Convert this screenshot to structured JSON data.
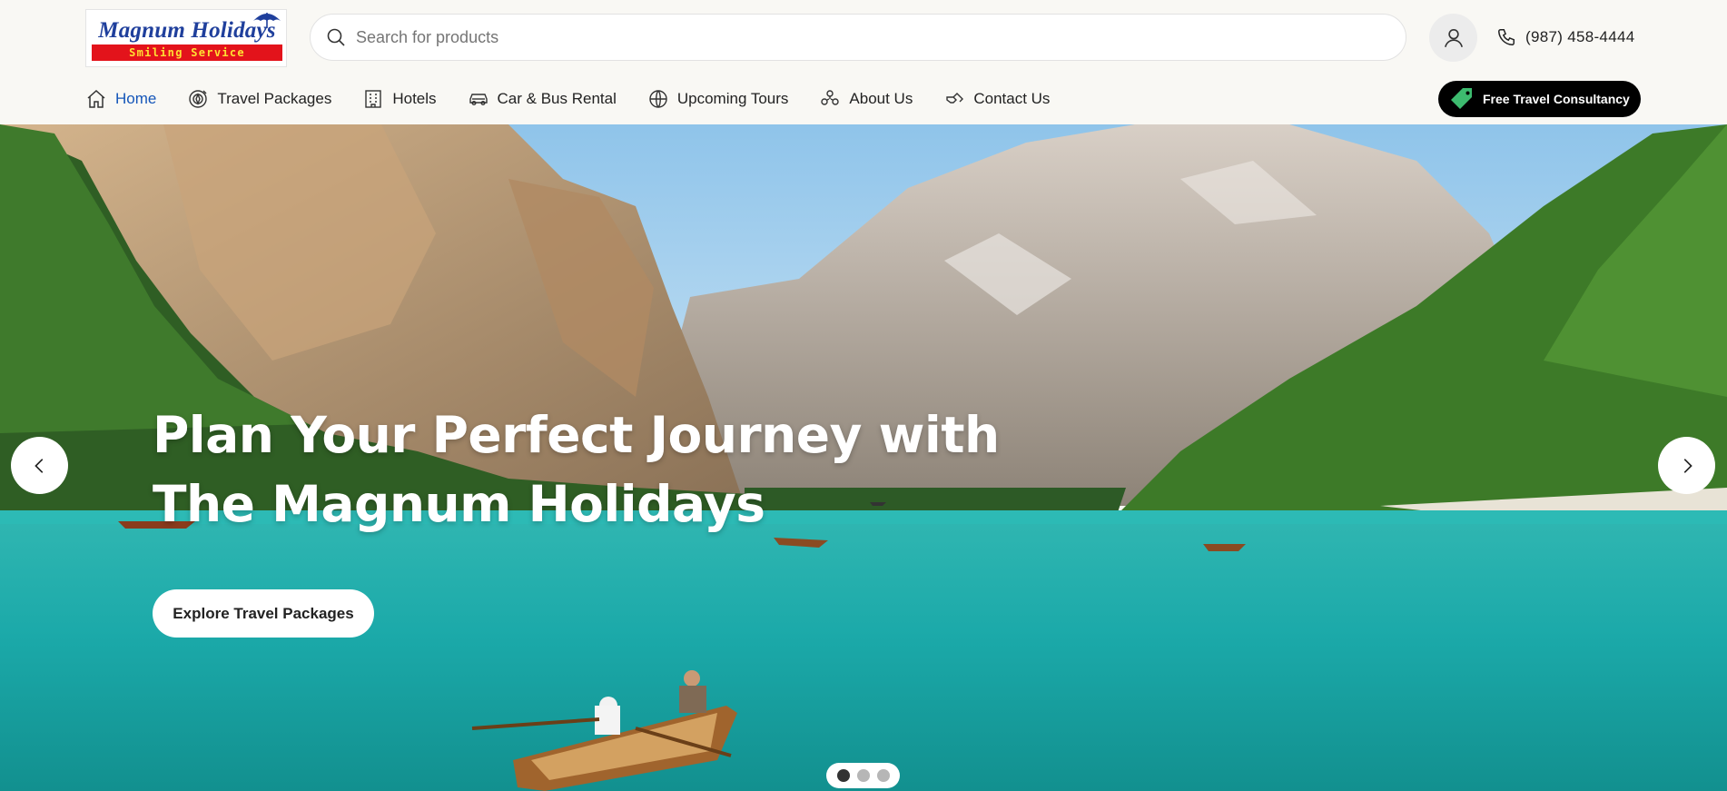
{
  "brand": {
    "logo_title": "Magnum Holidays",
    "logo_tagline": "Smiling Service"
  },
  "search": {
    "placeholder": "Search for products"
  },
  "contact": {
    "phone": "(987) 458-4444"
  },
  "nav": {
    "items": [
      {
        "label": "Home",
        "icon": "home-icon",
        "active": true
      },
      {
        "label": "Travel Packages",
        "icon": "travel-packages-icon"
      },
      {
        "label": "Hotels",
        "icon": "hotel-icon"
      },
      {
        "label": "Car & Bus Rental",
        "icon": "car-icon"
      },
      {
        "label": "Upcoming Tours",
        "icon": "tours-icon"
      },
      {
        "label": "About Us",
        "icon": "about-icon"
      },
      {
        "label": "Contact Us",
        "icon": "contact-icon"
      }
    ]
  },
  "cta_header": {
    "label": "Free Travel Consultancy",
    "icon": "price-tag-icon",
    "icon_color": "#3dbb6f"
  },
  "hero": {
    "title_line1": "Plan Your Perfect Journey with",
    "title_line2": "The Magnum Holidays",
    "button_label": "Explore Travel Packages",
    "slide_count": 3,
    "active_slide": 1
  },
  "colors": {
    "accent": "#1556b9",
    "header_bg": "#f9f8f4",
    "lake": "#1fb1b0"
  }
}
